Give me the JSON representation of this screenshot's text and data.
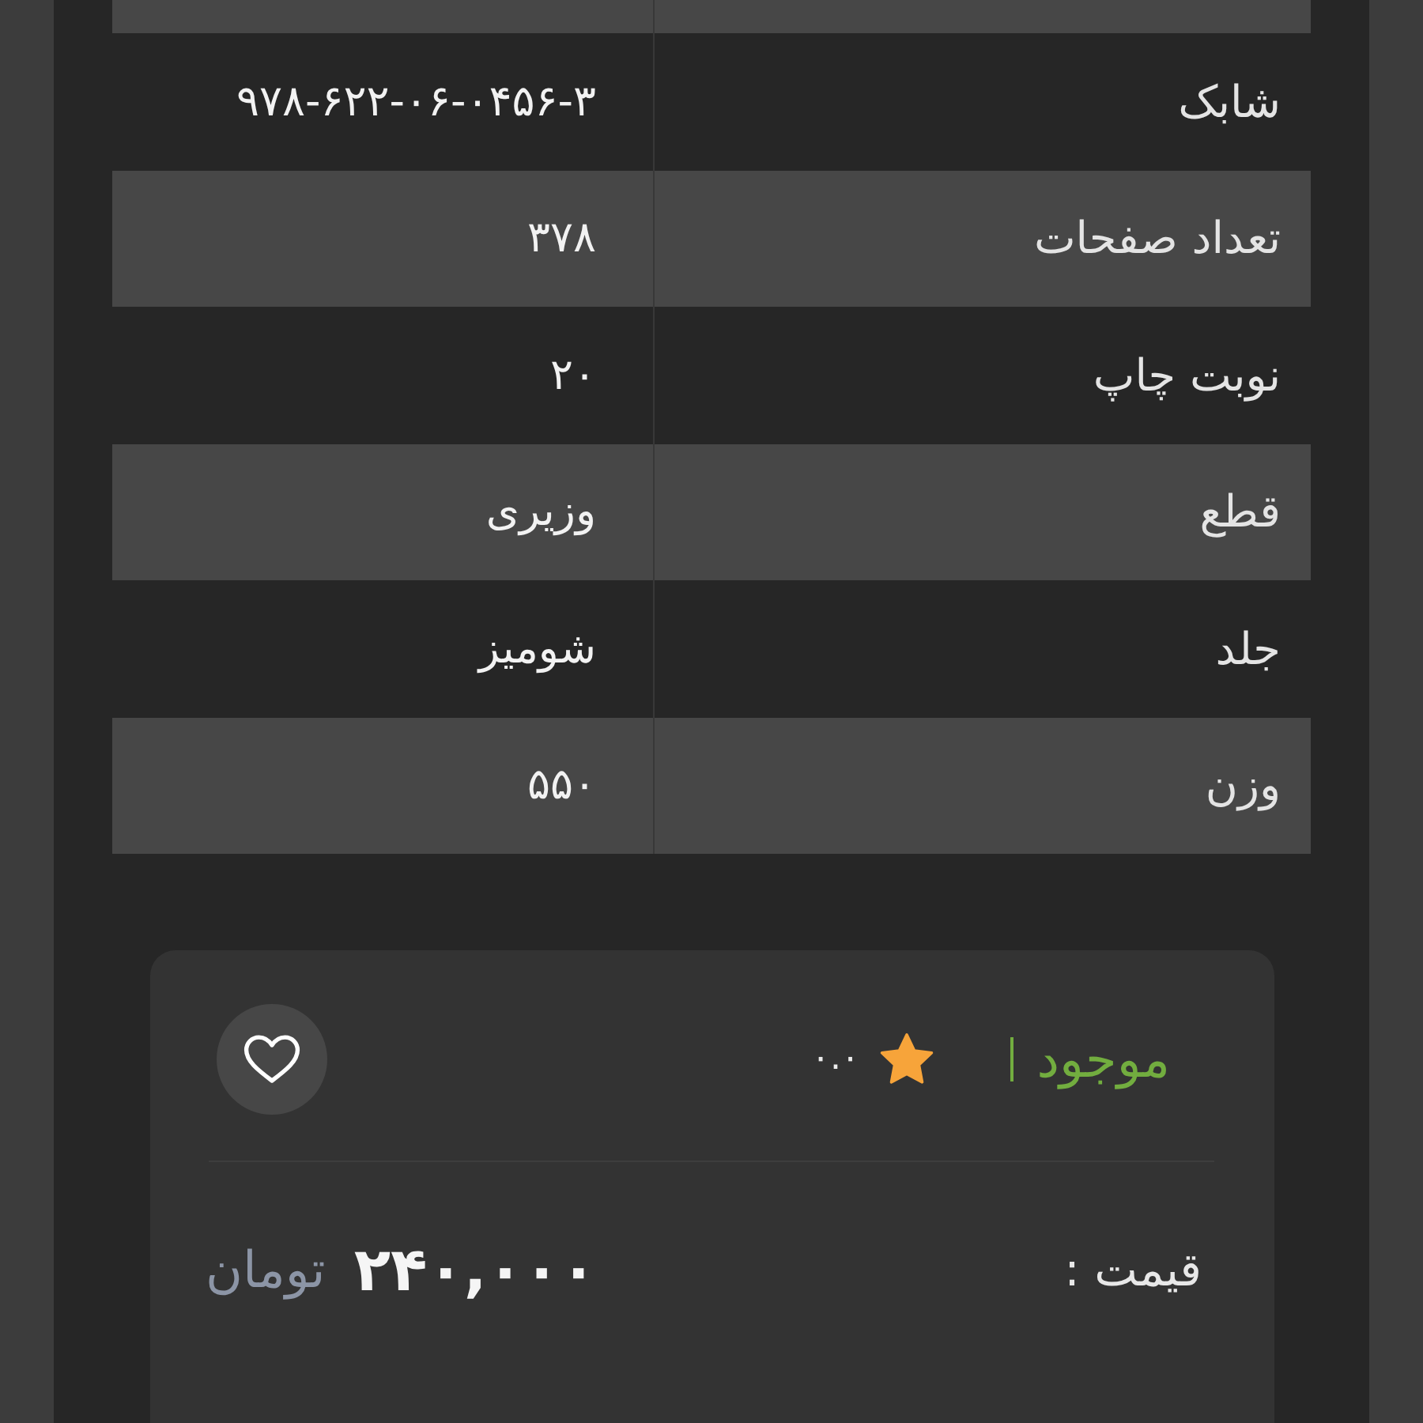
{
  "specs": {
    "rows": [
      {
        "label": "شابک",
        "value": "۹۷۸-۶۲۲-۰۶-۰۴۵۶-۳"
      },
      {
        "label": "تعداد صفحات",
        "value": "۳۷۸"
      },
      {
        "label": "نوبت چاپ",
        "value": "۲۰"
      },
      {
        "label": "قطع",
        "value": "وزیری"
      },
      {
        "label": "جلد",
        "value": "شومیز"
      },
      {
        "label": "وزن",
        "value": "۵۵۰"
      }
    ]
  },
  "purchase_card": {
    "availability": {
      "text": "موجود",
      "in_stock": true
    },
    "rating": "۰.۰",
    "favorite": false,
    "price_label": "قیمت :",
    "price": "۲۴۰,۰۰۰",
    "currency": "تومان"
  }
}
